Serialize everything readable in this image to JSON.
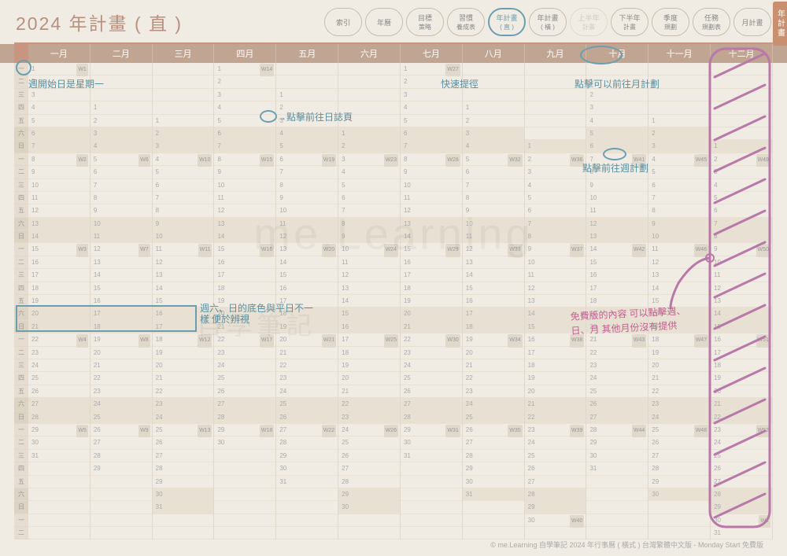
{
  "title": "2024 年計畫 ( 直 )",
  "nav_tabs": [
    {
      "l1": "索引",
      "l2": ""
    },
    {
      "l1": "年曆",
      "l2": ""
    },
    {
      "l1": "目標",
      "l2": "策略"
    },
    {
      "l1": "習慣",
      "l2": "養成表"
    },
    {
      "l1": "年計畫",
      "l2": "( 直 )",
      "active": true
    },
    {
      "l1": "年計畫",
      "l2": "( 橫 )"
    },
    {
      "l1": "上半年",
      "l2": "計畫",
      "disabled": true
    },
    {
      "l1": "下半年",
      "l2": "計畫"
    },
    {
      "l1": "季度",
      "l2": "規劃"
    },
    {
      "l1": "任務",
      "l2": "規劃表"
    },
    {
      "l1": "月計畫",
      "l2": ""
    }
  ],
  "side_tab": "年計畫",
  "months": [
    "一月",
    "二月",
    "三月",
    "四月",
    "五月",
    "六月",
    "七月",
    "八月",
    "九月",
    "十月",
    "十一月",
    "十二月"
  ],
  "dow_labels": [
    "一",
    "二",
    "三",
    "四",
    "五",
    "六",
    "日"
  ],
  "dow_cycle_count": 37,
  "month_data": [
    {
      "offset": 0,
      "days": 31,
      "weeks": {
        "1": "W1",
        "8": "W2",
        "15": "W3",
        "22": "W4",
        "29": "W5"
      }
    },
    {
      "offset": 3,
      "days": 29,
      "weeks": {
        "5": "W6",
        "12": "W7",
        "19": "W8",
        "26": "W9"
      }
    },
    {
      "offset": 4,
      "days": 31,
      "weeks": {
        "4": "W10",
        "11": "W11",
        "18": "W12",
        "25": "W13"
      }
    },
    {
      "offset": 0,
      "days": 30,
      "weeks": {
        "1": "W14",
        "8": "W15",
        "15": "W16",
        "22": "W17",
        "29": "W18"
      }
    },
    {
      "offset": 2,
      "days": 31,
      "weeks": {
        "6": "W19",
        "13": "W20",
        "20": "W21",
        "27": "W22"
      }
    },
    {
      "offset": 5,
      "days": 30,
      "weeks": {
        "3": "W23",
        "10": "W24",
        "17": "W25",
        "24": "W26"
      }
    },
    {
      "offset": 0,
      "days": 31,
      "weeks": {
        "1": "W27",
        "8": "W28",
        "15": "W29",
        "22": "W30",
        "29": "W31"
      }
    },
    {
      "offset": 3,
      "days": 31,
      "weeks": {
        "5": "W32",
        "12": "W33",
        "19": "W34",
        "26": "W35"
      }
    },
    {
      "offset": 6,
      "days": 30,
      "weeks": {
        "2": "W36",
        "9": "W37",
        "16": "W38",
        "23": "W39",
        "30": "W40"
      }
    },
    {
      "offset": 1,
      "days": 31,
      "weeks": {
        "7": "W41",
        "14": "W42",
        "21": "W43",
        "28": "W44"
      }
    },
    {
      "offset": 4,
      "days": 30,
      "weeks": {
        "4": "W45",
        "11": "W46",
        "18": "W47",
        "25": "W48"
      }
    },
    {
      "offset": 6,
      "days": 31,
      "weeks": {
        "2": "W49",
        "9": "W50",
        "16": "W51",
        "23": "W52",
        "30": "W1"
      }
    }
  ],
  "annotations": {
    "a1": "週開始日是星期一",
    "a2": "→點擊前往日誌頁",
    "a3": "快速提徑",
    "a4": "點擊可以前往月計劃",
    "a5": "點擊前往週計劃",
    "a6": "週六、日的底色與平日不一樣 便於辨視",
    "a7": "免費版的內容 可以點擊週、日、月 其他月份沒有提供"
  },
  "watermark1": "me.Learning",
  "watermark2": "自學筆記",
  "footer": "© me.Learning 自學筆記 2024 年行事曆 ( 橫式 ) 台灣繁體中文版 - Monday Start 免費版"
}
